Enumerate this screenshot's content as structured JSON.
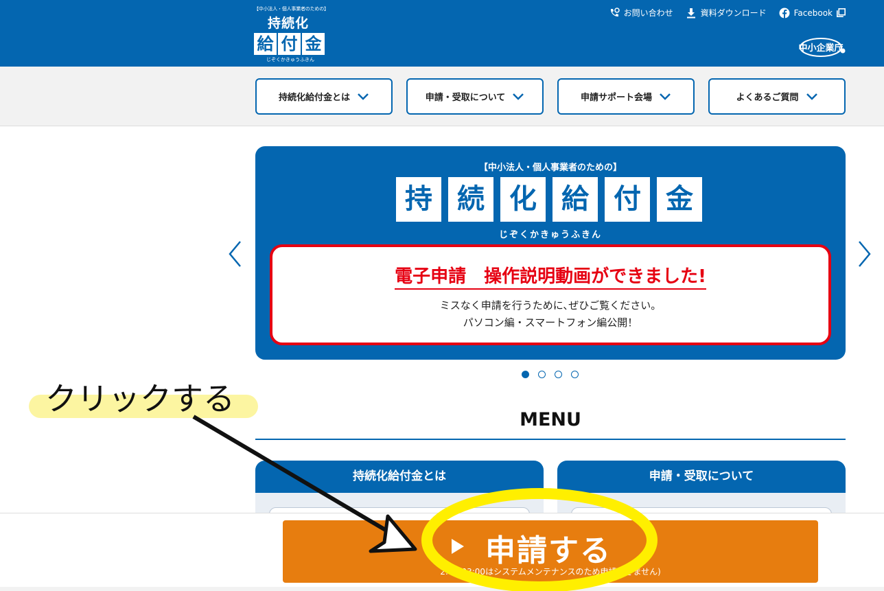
{
  "header": {
    "logo": {
      "top": "【中小法人・個人事業者のための】",
      "row1": "持続化",
      "row2": [
        "給",
        "付",
        "金"
      ],
      "ruby": "じぞくかきゅうふきん"
    },
    "links": [
      {
        "label": "お問い合わせ",
        "icon": "phone-icon"
      },
      {
        "label": "資料ダウンロード",
        "icon": "download-icon"
      },
      {
        "label": "Facebook",
        "icon": "facebook-icon"
      }
    ],
    "agency": "中小企業庁"
  },
  "nav": [
    {
      "label": "持続化給付金とは"
    },
    {
      "label": "申請・受取について"
    },
    {
      "label": "申請サポート会場"
    },
    {
      "label": "よくあるご質問"
    }
  ],
  "slide": {
    "sub": "【中小法人・個人事業者のための】",
    "tiles": [
      "持",
      "続",
      "化",
      "給",
      "付",
      "金"
    ],
    "ruby": "じぞくかきゅうふきん",
    "notice_title": "電子申請　操作説明動画ができました!",
    "notice_line1": "ミスなく申請を行うために､ぜひご覧ください。",
    "notice_line2": "パソコン編・スマートフォン編公開！"
  },
  "menu": {
    "title": "MENU",
    "cards": [
      {
        "label": "持続化給付金とは"
      },
      {
        "label": "申請・受取について"
      }
    ]
  },
  "annotation": {
    "text": "クリックする"
  },
  "apply": {
    "label": "申請する",
    "note": "2:00-03:00はシステムメンテナンスのため申請できません)"
  },
  "colors": {
    "brand_blue": "#0466b0",
    "apply_orange": "#e77d0f",
    "notice_red": "#e60012",
    "highlight_yellow": "#ffef00"
  }
}
